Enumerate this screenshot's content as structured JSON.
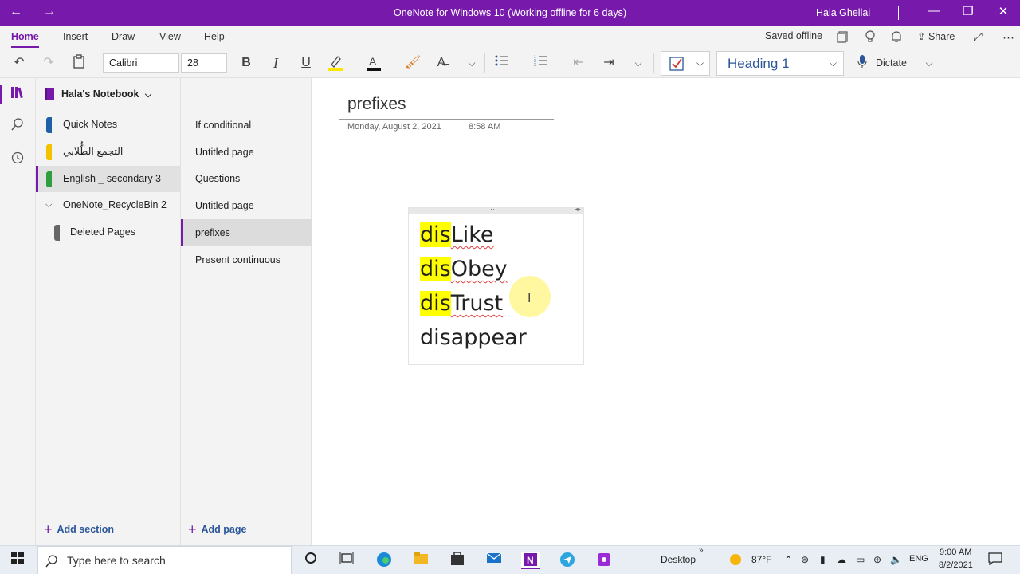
{
  "window": {
    "title": "OneNote for Windows 10 (Working offline for 6 days)",
    "user": "Hala Ghellai",
    "controls": {
      "minimize": "—",
      "restore": "❐",
      "close": "✕"
    },
    "nav": {
      "back": "←",
      "forward": "→"
    }
  },
  "ribbon": {
    "tabs": [
      "Home",
      "Insert",
      "Draw",
      "View",
      "Help"
    ],
    "active_tab": "Home",
    "status": "Saved offline",
    "share_label": "Share",
    "font_name": "Calibri",
    "font_size": "28",
    "style": "Heading 1",
    "dictate_label": "Dictate",
    "accent_color": "#7719aa"
  },
  "notebook": {
    "name": "Hala's Notebook",
    "sections": [
      {
        "label": "Quick Notes",
        "color": "#1f5fa6"
      },
      {
        "label": "التجمع الطُّلابي",
        "color": "#f2c200"
      },
      {
        "label": "English _ secondary 3",
        "color": "#2e9e3f"
      },
      {
        "label": "OneNote_RecycleBin 2",
        "color": ""
      },
      {
        "label": "Deleted Pages",
        "color": "#666666"
      }
    ],
    "selected_section": "English _ secondary 3",
    "add_section": "Add section"
  },
  "pages": {
    "items": [
      "If conditional",
      "Untitled page",
      "Questions",
      "Untitled page",
      "prefixes",
      "Present continuous"
    ],
    "selected": "prefixes",
    "add_page": "Add page"
  },
  "page": {
    "title": "prefixes",
    "date": "Monday, August 2, 2021",
    "time": "8:58 AM",
    "lines": [
      {
        "prefix": "dis",
        "rest": "Like"
      },
      {
        "prefix": "dis",
        "rest": "Obey"
      },
      {
        "prefix": "dis",
        "rest": "Trust"
      },
      {
        "prefix": "",
        "rest": "disappear"
      }
    ]
  },
  "taskbar": {
    "search_placeholder": "Type here to search",
    "desktop_label": "Desktop",
    "weather": "87°F",
    "language": "ENG",
    "time": "9:00 AM",
    "date": "8/2/2021"
  }
}
